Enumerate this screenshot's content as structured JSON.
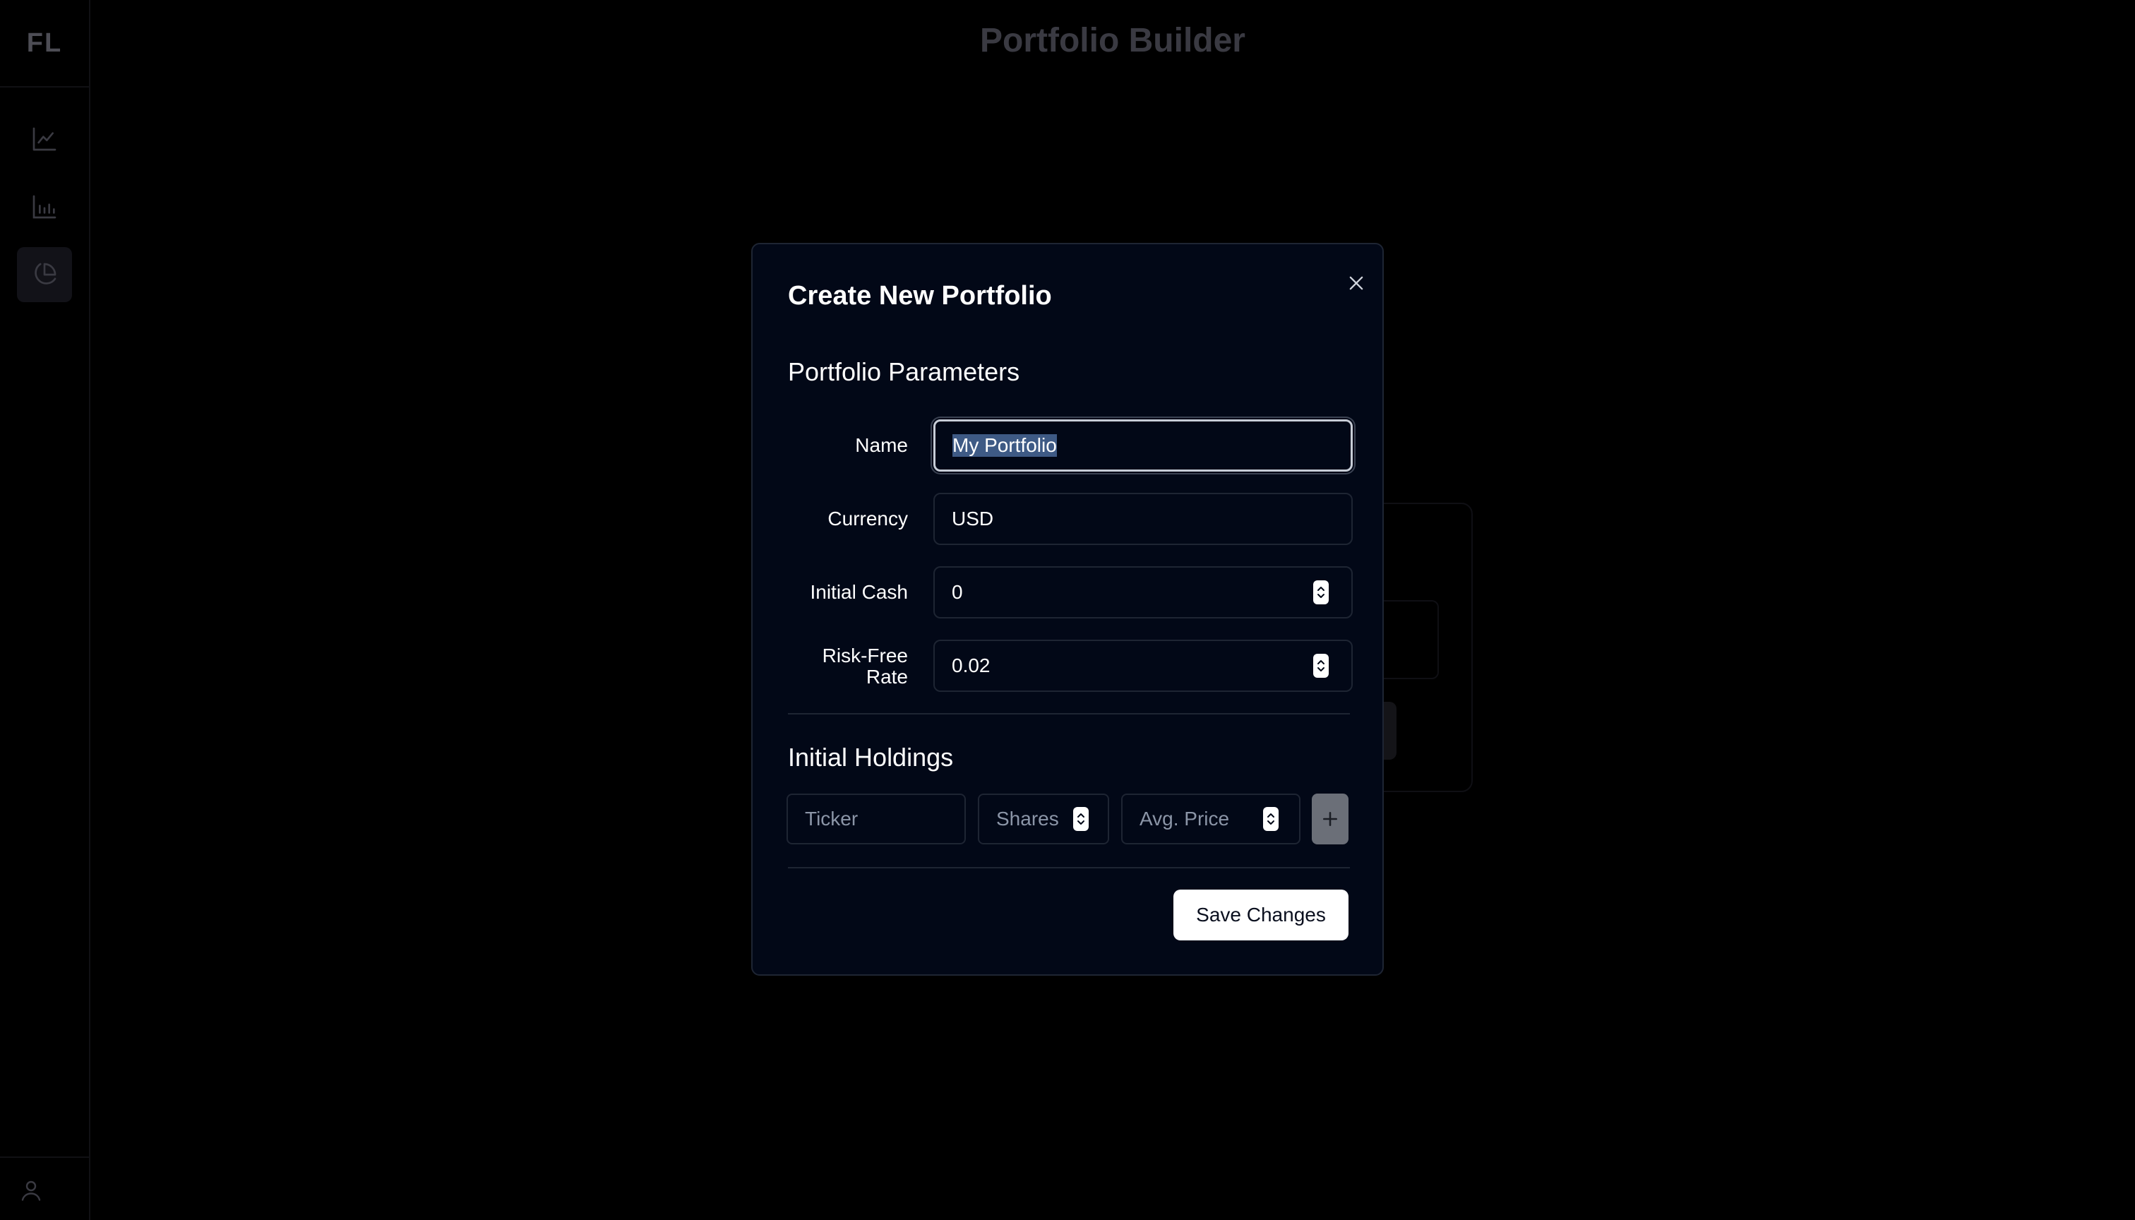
{
  "app": {
    "logo": "FL",
    "title": "Portfolio Builder",
    "nav": [
      {
        "icon": "line-chart-icon"
      },
      {
        "icon": "bar-chart-icon"
      },
      {
        "icon": "pie-chart-icon",
        "active": true
      }
    ],
    "user_icon": "user-icon"
  },
  "modal": {
    "title": "Create New Portfolio",
    "close_icon": "close-icon",
    "parameters": {
      "heading": "Portfolio Parameters",
      "name": {
        "label": "Name",
        "value": "My Portfolio"
      },
      "currency": {
        "label": "Currency",
        "value": "USD"
      },
      "initial_cash": {
        "label": "Initial Cash",
        "value": "0"
      },
      "risk_free_rate": {
        "label_line1": "Risk-Free",
        "label_line2": "Rate",
        "value": "0.02"
      }
    },
    "holdings": {
      "heading": "Initial Holdings",
      "ticker_placeholder": "Ticker",
      "shares_placeholder": "Shares",
      "avg_price_placeholder": "Avg. Price",
      "add_icon": "plus-icon"
    },
    "save_label": "Save Changes"
  },
  "colors": {
    "background": "#000000",
    "modal_bg": "#020817",
    "border": "#1e2533",
    "selection": "#3e5a85",
    "save_button_bg": "#ffffff"
  }
}
